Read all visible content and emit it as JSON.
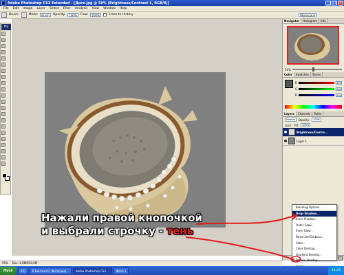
{
  "window": {
    "title": "Adobe Photoshop CS3 Extended - [Диск.jpg @ 50% (Brightness/Contrast 1, RGB/8)]",
    "controls": [
      "_",
      "□",
      "x"
    ]
  },
  "menubar": {
    "items": [
      "File",
      "Edit",
      "Image",
      "Layer",
      "Select",
      "Filter",
      "Analysis",
      "View",
      "Window",
      "Help"
    ]
  },
  "options_bar": {
    "brush_label": "Brush:",
    "mode_label": "Mode:",
    "mode_value": "Brush",
    "opacity_label": "Opacity:",
    "opacity_value": "100%",
    "flow_label": "Flow:",
    "flow_value": "100%",
    "erase_history": "Erase to History",
    "workspace_label": "Workspace"
  },
  "toolbox": {
    "badge": "Ps"
  },
  "status_bar": {
    "zoom": "50%",
    "doc_info": "Doc: 4,88M/20,0M"
  },
  "panels": {
    "navigator_tabs": [
      "Navigator",
      "Histogram",
      "Info"
    ],
    "navigator_zoom": "50%",
    "color_tabs": [
      "Color",
      "Swatches",
      "Styles"
    ],
    "color_channels": [
      {
        "label": "R",
        "value": "100"
      },
      {
        "label": "G",
        "value": "100"
      },
      {
        "label": "B",
        "value": "100"
      }
    ],
    "layers_tabs": [
      "Layers",
      "Channels",
      "Paths"
    ],
    "blend_mode": "Normal",
    "opacity_label": "Opacity:",
    "opacity_value": "100%",
    "lock_label": "Lock:",
    "fill_label": "Fill:",
    "fill_value": "100%",
    "layers": [
      {
        "name": "Brightness/Contra...",
        "selected": true
      },
      {
        "name": "Layer 1",
        "selected": false
      }
    ],
    "fx_button": "fx"
  },
  "context_menu": {
    "items": [
      {
        "label": "Blending Options...",
        "highlighted": false
      },
      {
        "label": "Drop Shadow...",
        "highlighted": true
      },
      {
        "label": "Inner Shadow...",
        "highlighted": false
      },
      {
        "label": "Outer Glow...",
        "highlighted": false
      },
      {
        "label": "Inner Glow...",
        "highlighted": false
      },
      {
        "label": "Bevel and Emboss...",
        "highlighted": false
      },
      {
        "label": "Satin...",
        "highlighted": false
      },
      {
        "label": "Color Overlay...",
        "highlighted": false
      },
      {
        "label": "Gradient Overlay...",
        "highlighted": false
      },
      {
        "label": "Pattern Overlay...",
        "highlighted": false
      },
      {
        "label": "Stroke...",
        "highlighted": false
      }
    ]
  },
  "annotation": {
    "line1": "Нажали правой кнопочкой",
    "line2_prefix": "и выбрали строчку - ",
    "line2_accent": "тень",
    "accent_color": "#e2211b"
  },
  "taskbar": {
    "start_label": "Пуск",
    "buttons": [
      {
        "label": "ICQ",
        "active": false
      },
      {
        "label": "В Контакте | Фотограф...",
        "active": false
      },
      {
        "label": "Adobe Photoshop CS3 ...",
        "active": true
      },
      {
        "label": "Фото 1",
        "active": false
      }
    ],
    "clock": "12:03"
  },
  "colors": {
    "titlebar": "#2c5dd0",
    "canvas_bg": "#808080",
    "highlight": "#0a246a",
    "arrow_red": "#e21a1a"
  }
}
